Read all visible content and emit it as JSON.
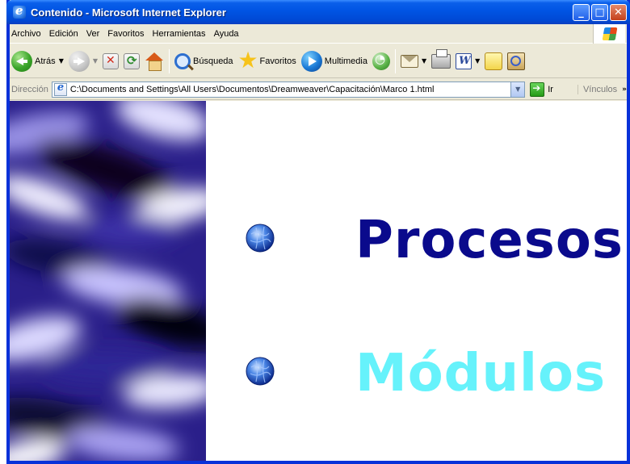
{
  "window": {
    "title": "Contenido - Microsoft Internet Explorer",
    "controls": {
      "minimize": "_",
      "maximize": "□",
      "close": "✕"
    }
  },
  "menubar": {
    "items": [
      {
        "label": "Archivo"
      },
      {
        "label": "Edición"
      },
      {
        "label": "Ver"
      },
      {
        "label": "Favoritos"
      },
      {
        "label": "Herramientas"
      },
      {
        "label": "Ayuda"
      }
    ]
  },
  "toolbar": {
    "back": {
      "label": "Atrás",
      "icon": "back-arrow-icon"
    },
    "forward": {
      "icon": "forward-arrow-icon"
    },
    "stop": {
      "icon": "stop-icon"
    },
    "refresh": {
      "icon": "refresh-icon"
    },
    "home": {
      "icon": "home-icon"
    },
    "search": {
      "label": "Búsqueda",
      "icon": "search-icon"
    },
    "favorites": {
      "label": "Favoritos",
      "icon": "star-icon"
    },
    "media": {
      "label": "Multimedia",
      "icon": "media-icon"
    },
    "history": {
      "icon": "history-icon"
    },
    "mail": {
      "icon": "mail-icon"
    },
    "print": {
      "icon": "print-icon"
    },
    "edit": {
      "icon": "word-icon"
    },
    "discuss": {
      "icon": "note-icon"
    },
    "research": {
      "icon": "research-icon"
    }
  },
  "addressbar": {
    "label": "Dirección",
    "value": "C:\\Documents and Settings\\All Users\\Documentos\\Dreamweaver\\Capacitación\\Marco 1.html",
    "go_label": "Ir",
    "links_label": "Vínculos",
    "more": "»"
  },
  "page": {
    "links": [
      {
        "label": "Procesos",
        "color": "#0a0a8c",
        "bullet_icon": "globe-bullet-icon"
      },
      {
        "label": "Módulos",
        "color": "#66f2fb",
        "bullet_icon": "globe-bullet-icon"
      }
    ],
    "left_frame": {
      "background": "blue wave texture",
      "colors": [
        "#05051f",
        "#2a1f8a",
        "#6b5fd0",
        "#eceaff"
      ]
    }
  },
  "colors": {
    "titlebar": "#0054e3",
    "frame": "#0831d9",
    "chrome": "#ece9d8"
  }
}
